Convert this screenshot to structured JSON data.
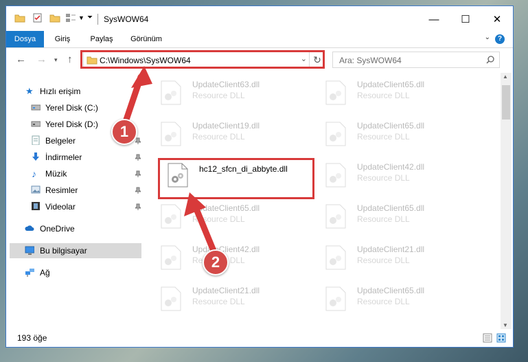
{
  "window": {
    "title": "SysWOW64",
    "controls": {
      "minimize": "—",
      "maximize": "☐",
      "close": "✕"
    }
  },
  "ribbon": {
    "tabs": [
      "Dosya",
      "Giriş",
      "Paylaş",
      "Görünüm"
    ],
    "help": "?"
  },
  "navbar": {
    "address": "C:\\Windows\\SysWOW64",
    "search_placeholder": "Ara: SysWOW64"
  },
  "sidebar": {
    "items": [
      {
        "label": "Hızlı erişim",
        "icon": "star-icon"
      },
      {
        "label": "Yerel Disk (C:)",
        "icon": "drive-icon"
      },
      {
        "label": "Yerel Disk (D:)",
        "icon": "drive-icon"
      },
      {
        "label": "Belgeler",
        "icon": "documents-icon"
      },
      {
        "label": "İndirmeler",
        "icon": "download-icon"
      },
      {
        "label": "Müzik",
        "icon": "music-icon"
      },
      {
        "label": "Resimler",
        "icon": "pictures-icon"
      },
      {
        "label": "Videolar",
        "icon": "video-icon"
      },
      {
        "label": "OneDrive",
        "icon": "cloud-icon"
      },
      {
        "label": "Bu bilgisayar",
        "icon": "computer-icon"
      },
      {
        "label": "Ağ",
        "icon": "network-icon"
      }
    ]
  },
  "files": {
    "left": [
      {
        "name": "UpdateClient63.dll",
        "type": "Resource DLL"
      },
      {
        "name": "UpdateClient19.dll",
        "type": "Resource DLL"
      },
      {
        "name": "hc12_sfcn_di_abbyte.dll",
        "type": ""
      },
      {
        "name": "UpdateClient65.dll",
        "type": "Resource DLL"
      },
      {
        "name": "UpdateClient42.dll",
        "type": "Resource DLL"
      },
      {
        "name": "UpdateClient21.dll",
        "type": "Resource DLL"
      }
    ],
    "right": [
      {
        "name": "UpdateClient65.dll",
        "type": "Resource DLL"
      },
      {
        "name": "UpdateClient65.dll",
        "type": "Resource DLL"
      },
      {
        "name": "UpdateClient42.dll",
        "type": "Resource DLL"
      },
      {
        "name": "UpdateClient65.dll",
        "type": "Resource DLL"
      },
      {
        "name": "UpdateClient21.dll",
        "type": "Resource DLL"
      },
      {
        "name": "UpdateClient65.dll",
        "type": "Resource DLL"
      }
    ]
  },
  "status": {
    "count": "193 öğe"
  },
  "annotations": {
    "step1": "1",
    "step2": "2",
    "color": "#d83a3a"
  }
}
